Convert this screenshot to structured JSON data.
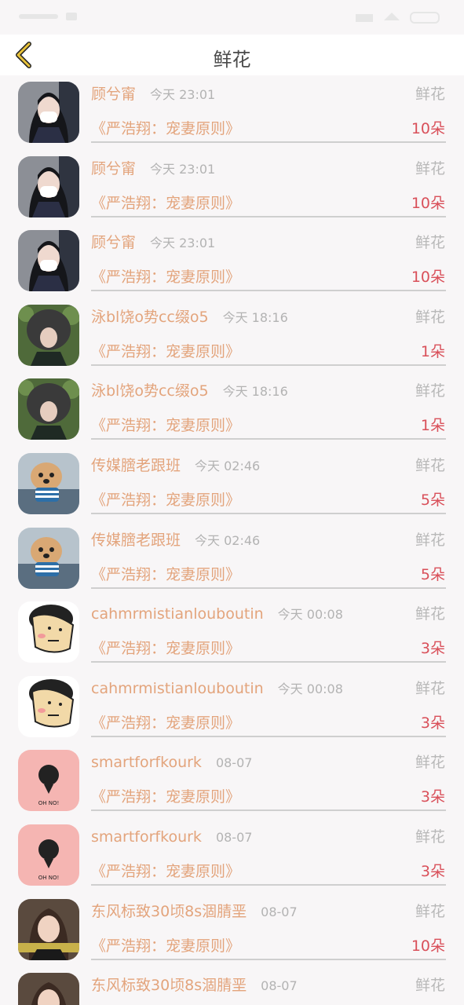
{
  "header": {
    "title": "鲜花"
  },
  "theme": {
    "name_color": "#e3a47c",
    "count_color": "#d9505a",
    "muted_color": "#b8b8b8"
  },
  "rows": [
    {
      "avatar": "girl-mask",
      "name": "顾兮甯",
      "time": "今天  23:01",
      "type": "鲜花",
      "book": "《严浩翔：宠妻原则》",
      "count": "10朵"
    },
    {
      "avatar": "girl-mask",
      "name": "顾兮甯",
      "time": "今天  23:01",
      "type": "鲜花",
      "book": "《严浩翔：宠妻原则》",
      "count": "10朵"
    },
    {
      "avatar": "girl-mask",
      "name": "顾兮甯",
      "time": "今天  23:01",
      "type": "鲜花",
      "book": "《严浩翔：宠妻原则》",
      "count": "10朵"
    },
    {
      "avatar": "shaggy-hair",
      "name": "泳bl饶o势cc缀o5",
      "time": "今天  18:16",
      "type": "鲜花",
      "book": "《严浩翔：宠妻原则》",
      "count": "1朵"
    },
    {
      "avatar": "shaggy-hair",
      "name": "泳bl饶o势cc缀o5",
      "time": "今天  18:16",
      "type": "鲜花",
      "book": "《严浩翔：宠妻原则》",
      "count": "1朵"
    },
    {
      "avatar": "dog",
      "name": "传媒膪老跟班",
      "time": "今天  02:46",
      "type": "鲜花",
      "book": "《严浩翔：宠妻原则》",
      "count": "5朵"
    },
    {
      "avatar": "dog",
      "name": "传媒膪老跟班",
      "time": "今天  02:46",
      "type": "鲜花",
      "book": "《严浩翔：宠妻原则》",
      "count": "5朵"
    },
    {
      "avatar": "cartoon-face",
      "name": "cahmrmistianlouboutin",
      "time": "今天  00:08",
      "type": "鲜花",
      "book": "《严浩翔：宠妻原则》",
      "count": "3朵"
    },
    {
      "avatar": "cartoon-face",
      "name": "cahmrmistianlouboutin",
      "time": "今天  00:08",
      "type": "鲜花",
      "book": "《严浩翔：宠妻原则》",
      "count": "3朵"
    },
    {
      "avatar": "oh-no",
      "avatar_text": "OH NO!",
      "name": "smartforfkourk",
      "time": "08-07",
      "type": "鲜花",
      "book": "《严浩翔：宠妻原则》",
      "count": "3朵"
    },
    {
      "avatar": "oh-no",
      "avatar_text": "OH NO!",
      "name": "smartforfkourk",
      "time": "08-07",
      "type": "鲜花",
      "book": "《严浩翔：宠妻原则》",
      "count": "3朵"
    },
    {
      "avatar": "girl-photo",
      "name": "东风标致30顷8s涸腈垩",
      "time": "08-07",
      "type": "鲜花",
      "book": "《严浩翔：宠妻原则》",
      "count": "10朵"
    },
    {
      "avatar": "girl-photo",
      "name": "东风标致30顷8s涸腈垩",
      "time": "08-07",
      "type": "鲜花",
      "book": "",
      "count": ""
    }
  ]
}
